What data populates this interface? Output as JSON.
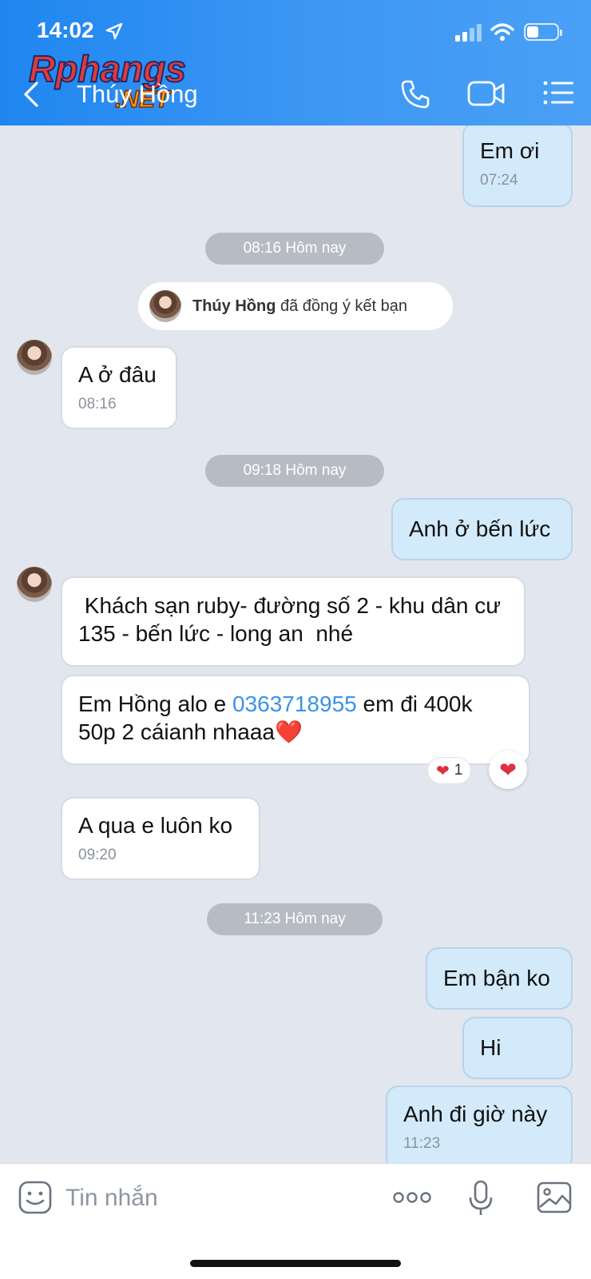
{
  "status_bar": {
    "time": "14:02"
  },
  "header": {
    "contact_name": "Thúy Hồng",
    "watermark_text": "Rphangs",
    "watermark_sub": ".NET"
  },
  "messages": [
    {
      "dir": "out",
      "text": "Em ơi",
      "time": "07:24"
    },
    {
      "kind": "day",
      "text": "08:16 Hôm nay"
    },
    {
      "kind": "system",
      "name": "Thúy Hồng",
      "text": "đã đồng ý kết bạn"
    },
    {
      "dir": "in",
      "text": "A ở đâu",
      "time": "08:16"
    },
    {
      "kind": "day",
      "text": "09:18 Hôm nay"
    },
    {
      "dir": "out",
      "text": "Anh ở bến lức"
    },
    {
      "dir": "in",
      "text": " Khách sạn ruby- đường số 2 - khu dân cư  135 - bến lức - long an  nhé"
    },
    {
      "dir": "in",
      "text_before": "Em Hồng alo e ",
      "phone": "0363718955",
      "text_after": " em đi 400k 50p 2 cáianh nhaaa❤️",
      "reaction_count": "1"
    },
    {
      "dir": "in",
      "text": "A qua e luôn ko",
      "time": "09:20"
    },
    {
      "kind": "day",
      "text": "11:23 Hôm nay"
    },
    {
      "dir": "out",
      "text": "Em bận ko"
    },
    {
      "dir": "out",
      "text": "Hi"
    },
    {
      "dir": "out",
      "text": "Anh đi giờ này",
      "time": "11:23"
    }
  ],
  "input": {
    "placeholder": "Tin nhắn"
  },
  "colors": {
    "header_start": "#1f86f0",
    "out_bubble": "#d3eafb",
    "in_bubble": "#ffffff",
    "chat_bg": "#e2e6ee",
    "link": "#3a92ea"
  }
}
